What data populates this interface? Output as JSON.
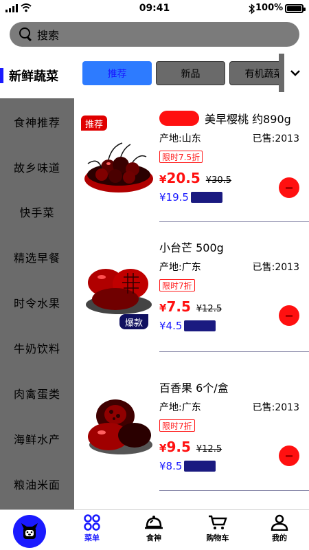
{
  "status_bar": {
    "time": "09:41",
    "battery": "100%"
  },
  "search": {
    "placeholder": "搜索"
  },
  "category": {
    "title": "新鲜蔬菜"
  },
  "tabs": [
    {
      "label": "推荐",
      "active": true
    },
    {
      "label": "新品",
      "active": false
    },
    {
      "label": "有机蔬菜",
      "active": false
    }
  ],
  "sidebar": {
    "items": [
      {
        "label": "食神推荐"
      },
      {
        "label": "故乡味道"
      },
      {
        "label": "快手菜"
      },
      {
        "label": "精选早餐"
      },
      {
        "label": "时令水果"
      },
      {
        "label": "牛奶饮料"
      },
      {
        "label": "肉禽蛋类"
      },
      {
        "label": "海鲜水产"
      },
      {
        "label": "粮油米面"
      }
    ]
  },
  "products": [
    {
      "name": "美早樱桃 约890g",
      "origin": "产地:山东",
      "sold": "已售:2013",
      "discount": "限时7.5折",
      "price_symbol": "¥",
      "price": "20.5",
      "old_price": "¥30.5",
      "vip_price": "¥19.5",
      "tag": "推荐"
    },
    {
      "name": "小台芒 500g",
      "origin": "产地:广东",
      "sold": "已售:2013",
      "discount": "限时7折",
      "price_symbol": "¥",
      "price": "7.5",
      "old_price": "¥12.5",
      "vip_price": "¥4.5",
      "tag": "爆款"
    },
    {
      "name": "百香果  6个/盒",
      "origin": "产地:广东",
      "sold": "已售:2013",
      "discount": "限时7折",
      "price_symbol": "¥",
      "price": "9.5",
      "old_price": "¥12.5",
      "vip_price": "¥8.5"
    }
  ],
  "nav": {
    "items": [
      {
        "label": "菜单",
        "active": true
      },
      {
        "label": "食神",
        "active": false
      },
      {
        "label": "购物车",
        "active": false
      },
      {
        "label": "我的",
        "active": false
      }
    ]
  },
  "colors": {
    "accent": "#1a1aff",
    "price": "#ff1010",
    "sidebar": "#6b6b6b"
  },
  "icons": [
    "signal-icon",
    "wifi-icon",
    "bluetooth-icon",
    "battery-icon",
    "search-icon",
    "chevron-down-icon",
    "cart-add-icon",
    "dog-logo-icon",
    "menu-grid-icon",
    "chef-cloche-icon",
    "cart-icon",
    "user-icon"
  ]
}
